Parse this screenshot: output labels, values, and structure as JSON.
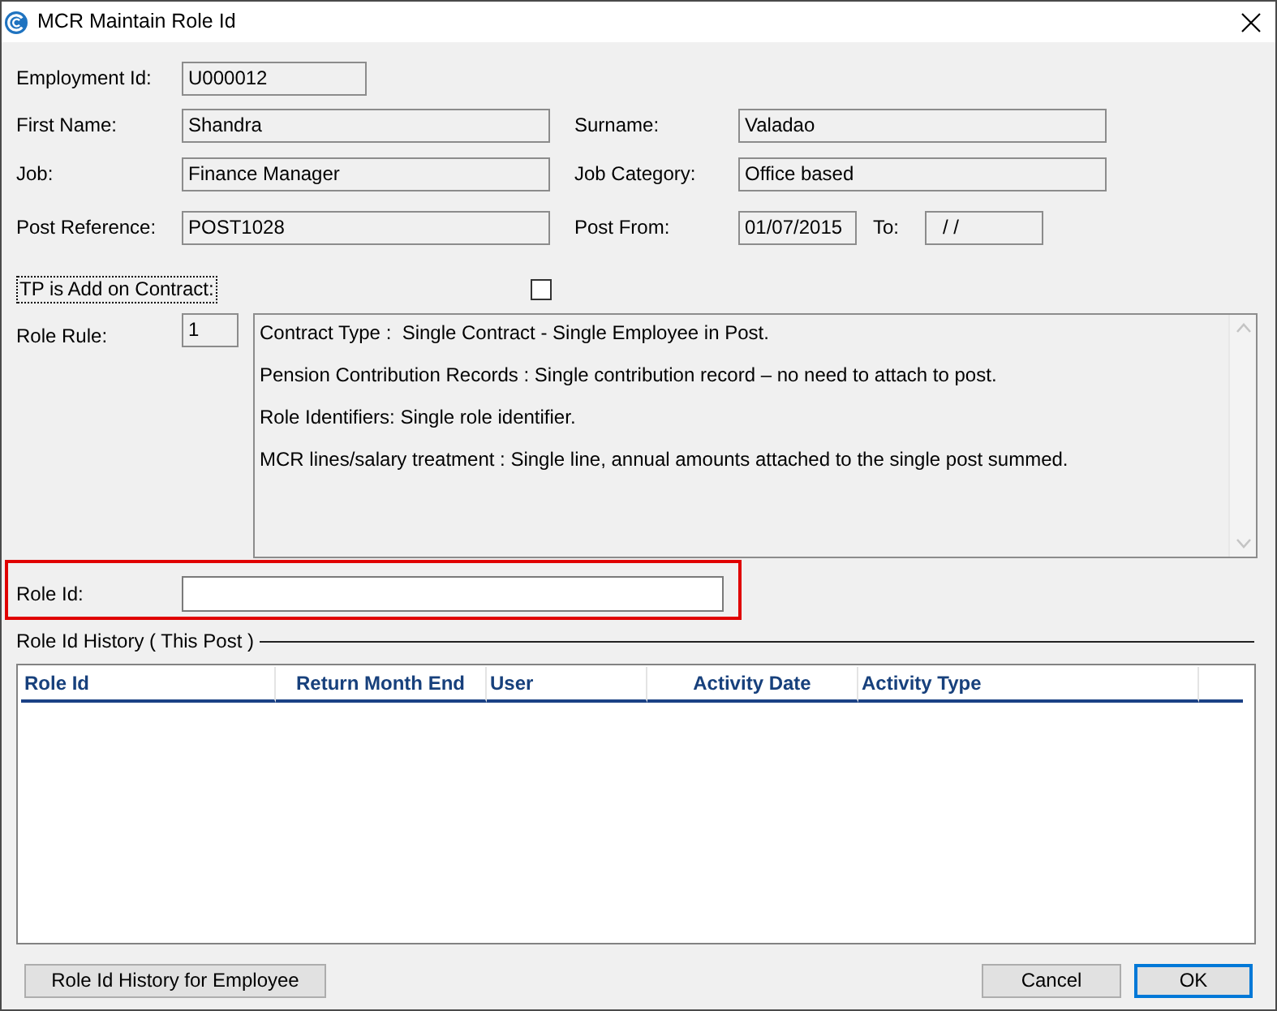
{
  "window": {
    "title": "MCR Maintain Role Id"
  },
  "employment_id": {
    "label": "Employment Id:",
    "value": "U000012"
  },
  "first_name": {
    "label": "First Name:",
    "value": "Shandra"
  },
  "surname": {
    "label": "Surname:",
    "value": "Valadao"
  },
  "job": {
    "label": "Job:",
    "value": "Finance Manager"
  },
  "job_category": {
    "label": "Job Category:",
    "value": "Office based"
  },
  "post_reference": {
    "label": "Post Reference:",
    "value": "POST1028"
  },
  "post_from": {
    "label": "Post From:",
    "value": "01/07/2015"
  },
  "post_to": {
    "label": "To:",
    "value": "/ /"
  },
  "tp_add_on_contract": {
    "label": "TP is Add on Contract:",
    "checked": false,
    "focused": true
  },
  "role_rule": {
    "label": "Role Rule:",
    "value": "1",
    "description": [
      "Contract Type :  Single Contract - Single Employee in Post.",
      "Pension Contribution Records : Single contribution record – no need to attach to post.",
      "Role Identifiers: Single role identifier.",
      "MCR lines/salary treatment : Single line, annual amounts attached to the single post summed."
    ]
  },
  "role_id": {
    "label": "Role Id:",
    "highlighted": true
  },
  "history": {
    "title": "Role Id History ( This Post )",
    "columns": [
      "Role Id",
      "Return Month End",
      "User",
      "Activity Date",
      "Activity Type"
    ]
  },
  "footer": {
    "left": [
      {
        "label": "Role Id History for Employee",
        "default": false
      }
    ],
    "right": [
      {
        "label": "Cancel",
        "default": false
      },
      {
        "label": "OK",
        "default": true
      }
    ]
  }
}
